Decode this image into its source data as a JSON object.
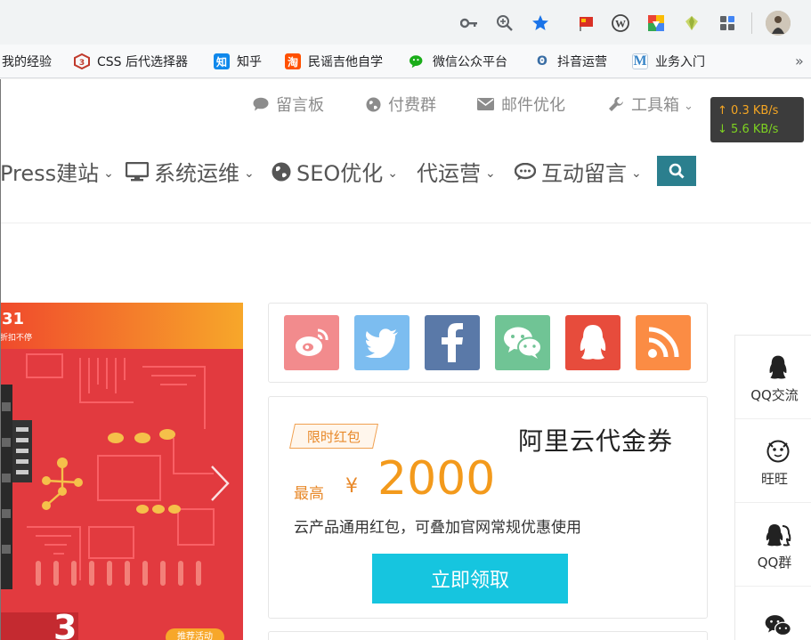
{
  "toolbar": {
    "icons": [
      "key-icon",
      "zoom-icon",
      "star-icon",
      "flag-extension-icon",
      "wordpress-icon",
      "chrome-extension-icon",
      "diamond-extension-icon",
      "puzzle-icon",
      "profile-avatar"
    ],
    "accent": "#1a73e8"
  },
  "bookmarks": [
    {
      "label": "我的经验",
      "icon": "none"
    },
    {
      "label": "CSS 后代选择器",
      "icon": "css-icon",
      "color": "#e44d26"
    },
    {
      "label": "知乎",
      "icon": "zhihu-icon",
      "glyph": "知",
      "color": "#0f88eb"
    },
    {
      "label": "民谣吉他自学",
      "icon": "taobao-icon",
      "glyph": "淘",
      "color": "#ff5000"
    },
    {
      "label": "微信公众平台",
      "icon": "wechat-icon",
      "color": "#1aad19"
    },
    {
      "label": "抖音运营",
      "icon": "douyin-icon",
      "glyph": "ʘ",
      "color": "#3a6ea5"
    },
    {
      "label": "业务入门",
      "icon": "medium-icon",
      "glyph": "M",
      "color": "#3a86c8"
    }
  ],
  "topnav": [
    {
      "label": "留言板",
      "icon": "comment-icon"
    },
    {
      "label": "付费群",
      "icon": "globe-icon"
    },
    {
      "label": "邮件优化",
      "icon": "envelope-icon"
    },
    {
      "label": "工具箱",
      "icon": "wrench-icon"
    }
  ],
  "speed": {
    "up": "0.3 KB/s",
    "down": "5.6 KB/s",
    "up_arrow": "↑",
    "down_arrow": "↓"
  },
  "mainnav": [
    {
      "label": "Press建站",
      "icon": "none"
    },
    {
      "label": "系统运维",
      "icon": "monitor-icon"
    },
    {
      "label": "SEO优化",
      "icon": "globe-icon"
    },
    {
      "label": "代运营",
      "icon": "none"
    },
    {
      "label": "互动留言",
      "icon": "comments-icon"
    }
  ],
  "caret": "⌄",
  "banner": {
    "title": "31",
    "subtitle": "折扣不停",
    "badge": "推荐活动",
    "accent": "#e8323a"
  },
  "share": [
    {
      "name": "weibo",
      "color": "#f28b8d"
    },
    {
      "name": "twitter",
      "color": "#7cbdf0"
    },
    {
      "name": "facebook",
      "color": "#5a79a8"
    },
    {
      "name": "wechat",
      "color": "#70c495"
    },
    {
      "name": "qq",
      "color": "#e74c3c"
    },
    {
      "name": "rss",
      "color": "#fb8c44"
    }
  ],
  "coupon": {
    "tag": "限时红包",
    "title": "阿里云代金券",
    "prefix": "最高",
    "currency": "¥",
    "amount": "2000",
    "desc": "云产品通用红包，可叠加官网常规优惠使用",
    "button": "立即领取",
    "button_color": "#16c5df"
  },
  "rightbar": [
    {
      "label": "QQ交流",
      "icon": "qq-icon"
    },
    {
      "label": "旺旺",
      "icon": "wangwang-icon"
    },
    {
      "label": "QQ群",
      "icon": "qq-group-icon"
    },
    {
      "label": "",
      "icon": "wechat-icon"
    }
  ]
}
